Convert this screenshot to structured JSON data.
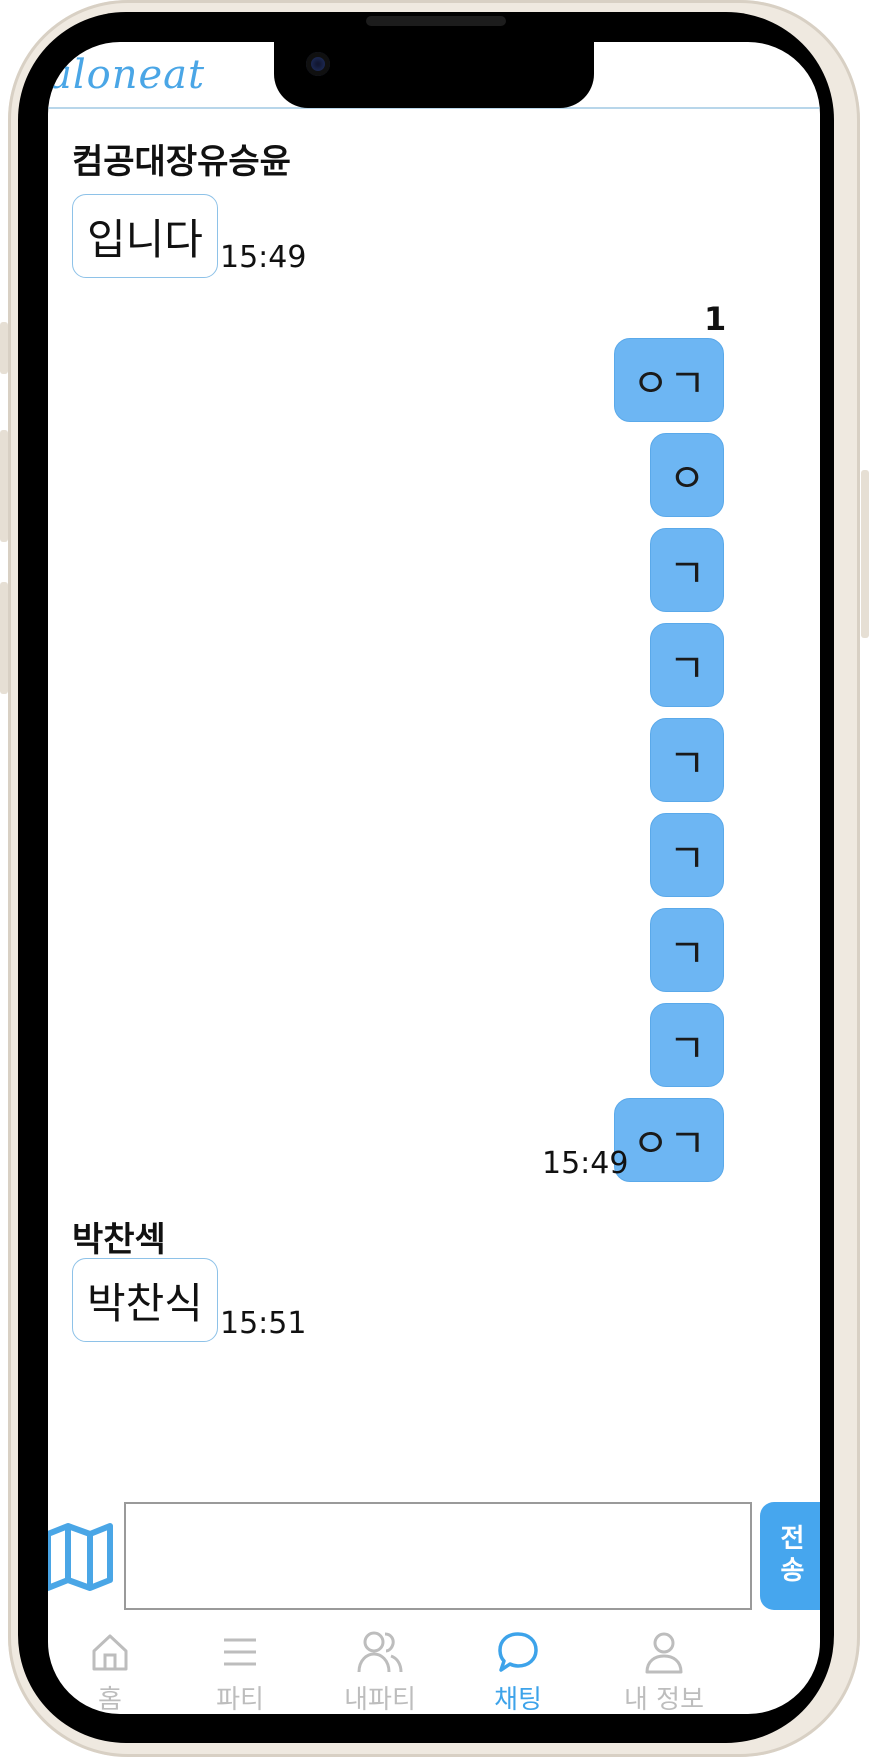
{
  "header": {
    "logo": "aloneat"
  },
  "messages": [
    {
      "sender": "컴공대장유승윤",
      "text": "입니다",
      "time": "15:49"
    }
  ],
  "my_messages": {
    "read_count": "1",
    "items": [
      "ㅇㄱ",
      "ㅇ",
      "ㄱ",
      "ㄱ",
      "ㄱ",
      "ㄱ",
      "ㄱ",
      "ㄱ",
      "ㅇㄱ"
    ],
    "time": "15:49"
  },
  "messages2": [
    {
      "sender": "박찬섹",
      "text": "박찬식",
      "time": "15:51"
    }
  ],
  "input": {
    "placeholder": "",
    "value": "",
    "send_label": "전송"
  },
  "nav": {
    "items": [
      {
        "label": "홈",
        "icon": "home-icon"
      },
      {
        "label": "파티",
        "icon": "list-icon"
      },
      {
        "label": "내파티",
        "icon": "people-icon"
      },
      {
        "label": "채팅",
        "icon": "chat-icon"
      },
      {
        "label": "내 정보",
        "icon": "user-icon"
      }
    ],
    "active": "채팅"
  },
  "colors": {
    "accent": "#46a6ee",
    "bubble_out": "#6db6f3",
    "bubble_in_border": "#8ec2e8"
  }
}
